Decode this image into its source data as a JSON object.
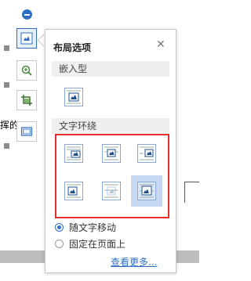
{
  "background": {
    "partial_text": "挥的",
    "colors": {
      "bottom_bar": "#bdbdbd",
      "handle": "#8c8c8c"
    }
  },
  "side_toolbar": {
    "buttons": [
      {
        "name": "collapse",
        "icon": "minus-circle-icon"
      },
      {
        "name": "layout-options",
        "icon": "image-layout-icon",
        "active": true
      },
      {
        "name": "zoom",
        "icon": "zoom-in-icon"
      },
      {
        "name": "crop",
        "icon": "crop-icon"
      },
      {
        "name": "border",
        "icon": "frame-icon"
      }
    ],
    "accent": "#2e6fc4"
  },
  "popup": {
    "title": "布局选项",
    "close_icon": "close-icon",
    "inline_section": {
      "heading": "嵌入型",
      "options": [
        {
          "name": "inline",
          "icon": "wrap-inline-icon"
        }
      ]
    },
    "wrap_section": {
      "heading": "文字环绕",
      "options": [
        {
          "name": "square",
          "icon": "wrap-square-icon"
        },
        {
          "name": "tight",
          "icon": "wrap-tight-icon"
        },
        {
          "name": "through",
          "icon": "wrap-through-icon"
        },
        {
          "name": "top-bottom",
          "icon": "wrap-top-bottom-icon"
        },
        {
          "name": "behind-text",
          "icon": "wrap-behind-text-icon"
        },
        {
          "name": "in-front-of-text",
          "icon": "wrap-in-front-icon",
          "selected": true
        }
      ],
      "highlight_color": "#e0312f"
    },
    "radio_options": [
      {
        "label": "随文字移动",
        "checked": true
      },
      {
        "label": "固定在页面上",
        "checked": false
      }
    ],
    "more_link": "查看更多..."
  }
}
